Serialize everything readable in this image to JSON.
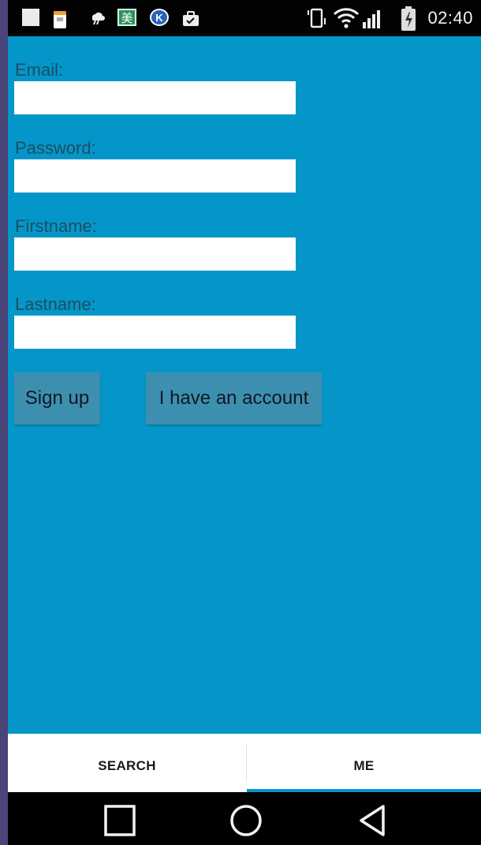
{
  "status_bar": {
    "time": "02:40",
    "icons": [
      "square-notification-icon",
      "calendar-icon",
      "weather-icon",
      "mei-app-icon",
      "k-app-icon",
      "shopping-bag-icon",
      "phone-vibrate-icon",
      "wifi-icon",
      "signal-icon",
      "battery-icon"
    ],
    "mei_glyph": "美",
    "k_glyph": "K"
  },
  "form": {
    "email_label": "Email:",
    "email_value": "",
    "password_label": "Password:",
    "password_value": "",
    "firstname_label": "Firstname:",
    "firstname_value": "",
    "lastname_label": "Lastname:",
    "lastname_value": ""
  },
  "actions": {
    "sign_up_label": "Sign up",
    "have_account_label": "I have an account"
  },
  "tabs": [
    {
      "label": "SEARCH",
      "selected": false
    },
    {
      "label": "ME",
      "selected": true
    }
  ],
  "nav_bar": {
    "icons": [
      "recent-apps-icon",
      "home-icon",
      "back-icon"
    ]
  },
  "colors": {
    "background": "#0596c9",
    "button": "#3d8fb0",
    "label_text": "#1b4e63",
    "status_bar": "#020202",
    "tab_bar": "#ffffff"
  }
}
